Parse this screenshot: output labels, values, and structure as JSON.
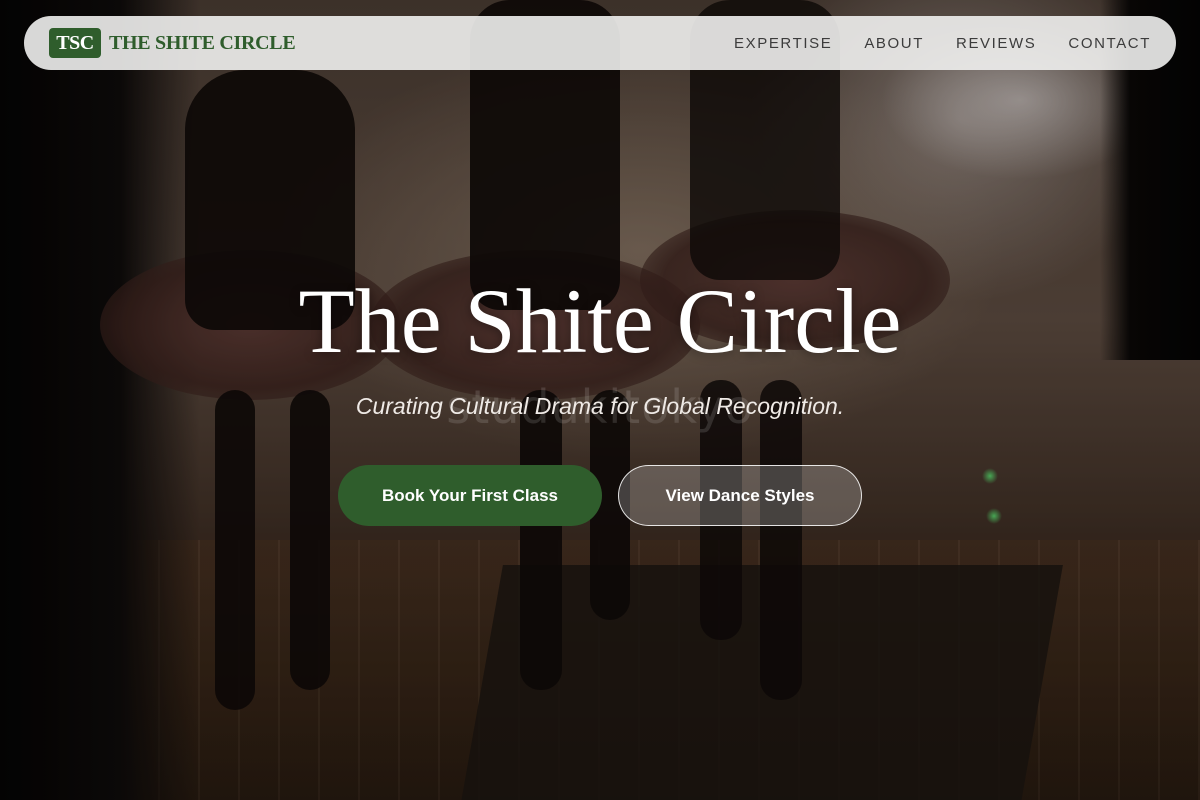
{
  "colors": {
    "brand_green": "#2f5d2c",
    "nav_background": "#f0f0ee",
    "nav_text": "#3c3c3c",
    "hero_text": "#ffffff"
  },
  "nav": {
    "brand_badge": "TSC",
    "brand_name": "THE SHITE CIRCLE",
    "links": [
      "EXPERTISE",
      "ABOUT",
      "REVIEWS",
      "CONTACT"
    ]
  },
  "hero": {
    "title": "The Shite Circle",
    "subtitle": "Curating Cultural Drama for Global Recognition.",
    "watermark": "studukitokyo",
    "background_image": "ballet-dancers-backstage-photo",
    "primary_button": "Book Your First Class",
    "secondary_button": "View Dance Styles"
  }
}
